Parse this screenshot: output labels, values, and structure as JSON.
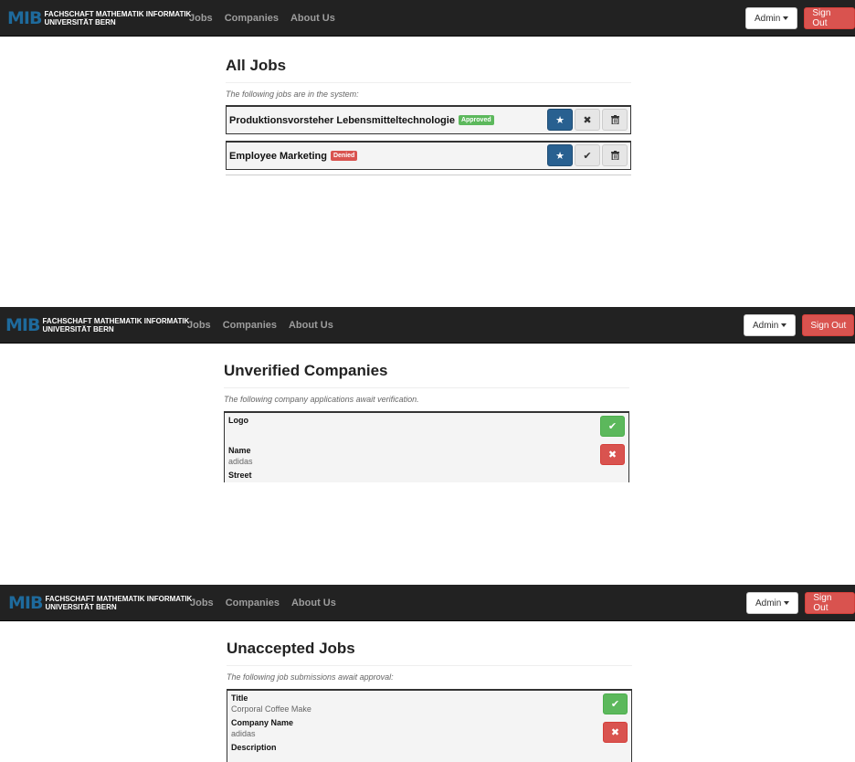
{
  "brand": {
    "logo_mark": "MIB",
    "line1": "FACHSCHAFT MATHEMATIK INFORMATIK",
    "line2": "UNIVERSITÄT BERN",
    "accent": "#1e6a9c"
  },
  "nav": {
    "links": [
      "Jobs",
      "Companies",
      "About Us"
    ],
    "admin_label": "Admin",
    "signout_label": "Sign Out"
  },
  "all_jobs": {
    "heading": "All Jobs",
    "note": "The following jobs are in the system:",
    "rows": [
      {
        "title": "Produktionsvorsteher Lebensmitteltechnologie",
        "status": "Approved",
        "status_color": "#5cb85c",
        "icons": [
          "star-icon",
          "x-icon",
          "trash-icon"
        ]
      },
      {
        "title": "Employee Marketing",
        "status": "Denied",
        "status_color": "#d9534f",
        "icons": [
          "star-icon",
          "check-icon",
          "trash-icon"
        ]
      }
    ]
  },
  "unverified_companies": {
    "heading": "Unverified Companies",
    "note": "The following company applications await verification.",
    "fields": [
      {
        "label": "Logo",
        "value": ""
      },
      {
        "label": "Name",
        "value": "adidas"
      },
      {
        "label": "Street",
        "value": ""
      }
    ]
  },
  "unaccepted_jobs": {
    "heading": "Unaccepted Jobs",
    "note": "The following job submissions await approval:",
    "fields": [
      {
        "label": "Title",
        "value": "Corporal Coffee Make"
      },
      {
        "label": "Company Name",
        "value": "adidas"
      },
      {
        "label": "Description",
        "value": ""
      }
    ]
  },
  "colors": {
    "navbar": "#222222",
    "primary": "#286090",
    "success": "#5cb85c",
    "danger": "#d9534f"
  }
}
